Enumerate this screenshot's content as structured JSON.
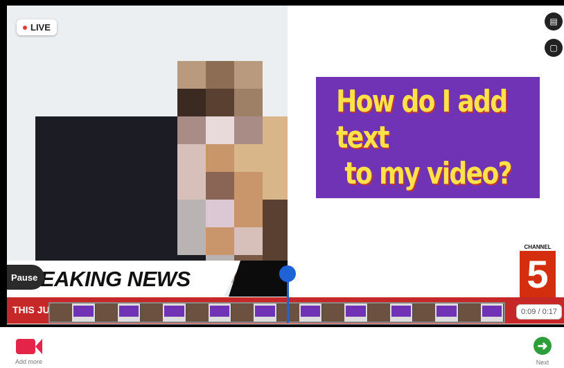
{
  "preview": {
    "live_label": "LIVE",
    "pause_label": "Pause",
    "banner_text": "EAKING NEWS"
  },
  "title_card": {
    "line1": "How do I add text",
    "line2": "to my video?"
  },
  "channel_logo": {
    "label": "CHANNEL",
    "number": "5"
  },
  "ticker": {
    "text": "THIS JU"
  },
  "timeline": {
    "time": "0:09 / 0:17",
    "frame_count": 10,
    "progress": 0.53
  },
  "side_buttons": [
    {
      "icon": "layout-icon"
    },
    {
      "icon": "comment-icon"
    }
  ],
  "bottom_bar": {
    "add_more_label": "Add more",
    "next_label": "Next"
  },
  "colors": {
    "accent_red": "#e5244a",
    "title_bg": "#7133b5",
    "title_text": "#ffe14a",
    "playhead": "#1e63d6",
    "next_green": "#2e9e3b"
  }
}
